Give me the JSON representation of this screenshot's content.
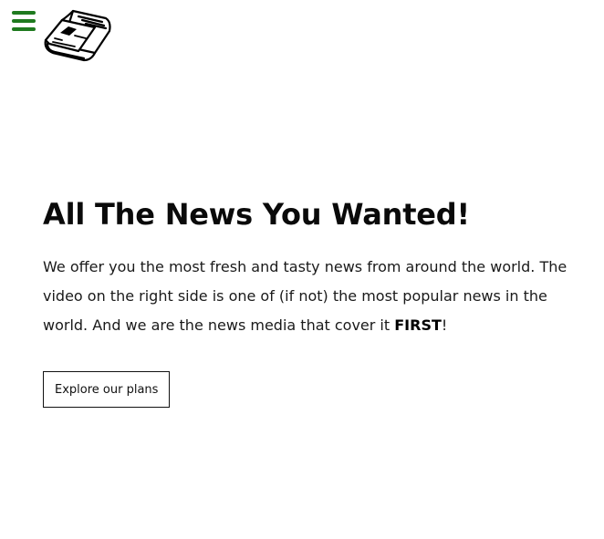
{
  "header": {
    "menu_icon": "hamburger-menu-icon",
    "menu_color": "#1f7a1f",
    "logo_icon": "newspaper-icon"
  },
  "hero": {
    "title": "All The News You Wanted!",
    "text_before_bold": "We offer you the most fresh and tasty news from around the world. The video on the right side is one of (if not) the most popular news in the world. And we are the news media that cover it ",
    "text_bold": "FIRST",
    "text_after_bold": "!",
    "cta_label": "Explore our plans"
  }
}
